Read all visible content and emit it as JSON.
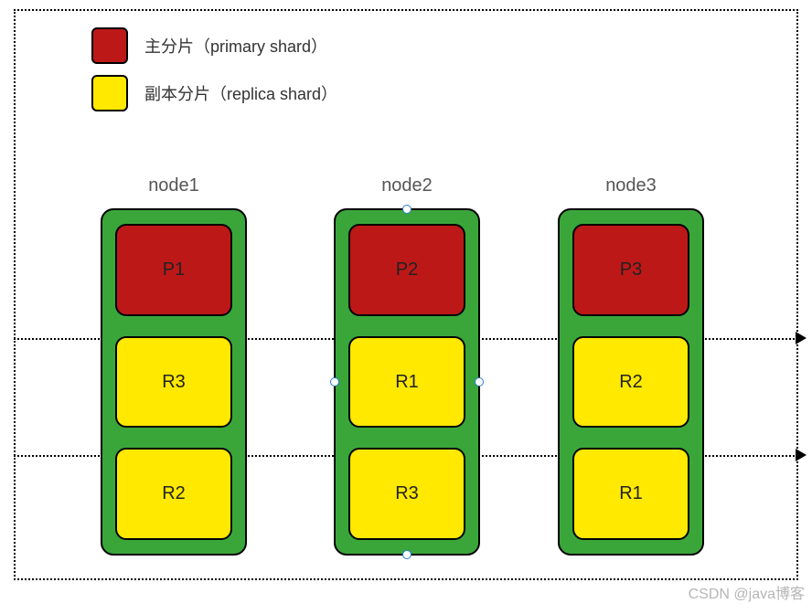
{
  "legend": {
    "primary_label": "主分片（primary shard）",
    "replica_label": "副本分片（replica shard）"
  },
  "nodes": {
    "node1": {
      "label": "node1",
      "shard1": "P1",
      "shard2": "R3",
      "shard3": "R2"
    },
    "node2": {
      "label": "node2",
      "shard1": "P2",
      "shard2": "R1",
      "shard3": "R3"
    },
    "node3": {
      "label": "node3",
      "shard1": "P3",
      "shard2": "R2",
      "shard3": "R1"
    }
  },
  "watermark": "CSDN @java博客"
}
